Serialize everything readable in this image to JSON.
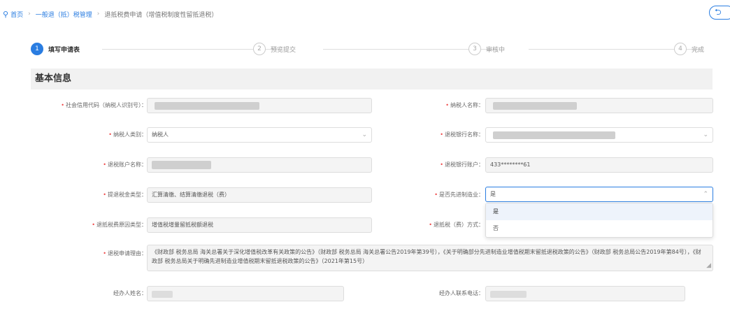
{
  "breadcrumb": {
    "items": [
      "首页",
      "一般退（抵）税管理",
      "退抵税费申请（增值税制度性留抵退税）"
    ],
    "back_label": "⮌"
  },
  "steps": [
    {
      "num": "1",
      "label": "填写申请表",
      "active": true
    },
    {
      "num": "2",
      "label": "预览提交",
      "active": false
    },
    {
      "num": "3",
      "label": "审核中",
      "active": false
    },
    {
      "num": "4",
      "label": "完成",
      "active": false
    }
  ],
  "section_title": "基本信息",
  "form": {
    "credit_code": {
      "label": "社会信用代码（纳税人识别号）：",
      "value": ""
    },
    "taxpayer_name": {
      "label": "纳税人名称：",
      "value": ""
    },
    "taxpayer_type": {
      "label": "纳税人类别：",
      "value": "纳税人"
    },
    "refund_bank": {
      "label": "退税银行名称：",
      "value": ""
    },
    "account_name": {
      "label": "退税账户名称：",
      "value": ""
    },
    "bank_account": {
      "label": "退税银行账户：",
      "value": "433********61"
    },
    "refund_category": {
      "label": "提退税金类型：",
      "value": "汇算清缴、结算清缴退税（费）"
    },
    "advanced_mfg": {
      "label": "是否先进制造业：",
      "value": "是",
      "options": [
        "是",
        "否"
      ]
    },
    "refund_reason_type": {
      "label": "退抵税费原因类型：",
      "value": "增值税增量留抵税额退税"
    },
    "refund_method": {
      "label": "退抵税（费）方式：",
      "value": ""
    },
    "refund_reason": {
      "label": "退税申请理由：",
      "value": "《财政部 税务总局 海关总署关于深化增值税改革有关政策的公告》（财政部 税务总局 海关总署公告2019年第39号），《关于明确部分先进制造业增值税期末留抵退税政策的公告》（财政部 税务总局公告2019年第84号），《财政部 税务总局关于明确先进制造业增值税期末留抵退税政策的公告》（2021年第15号）"
    },
    "agent_name": {
      "label": "经办人姓名：",
      "value": ""
    },
    "agent_phone": {
      "label": "经办人联系电话：",
      "value": ""
    }
  },
  "icons": {
    "chevron": "⌄",
    "chevron_up": "⌃",
    "pin": "⚲"
  }
}
